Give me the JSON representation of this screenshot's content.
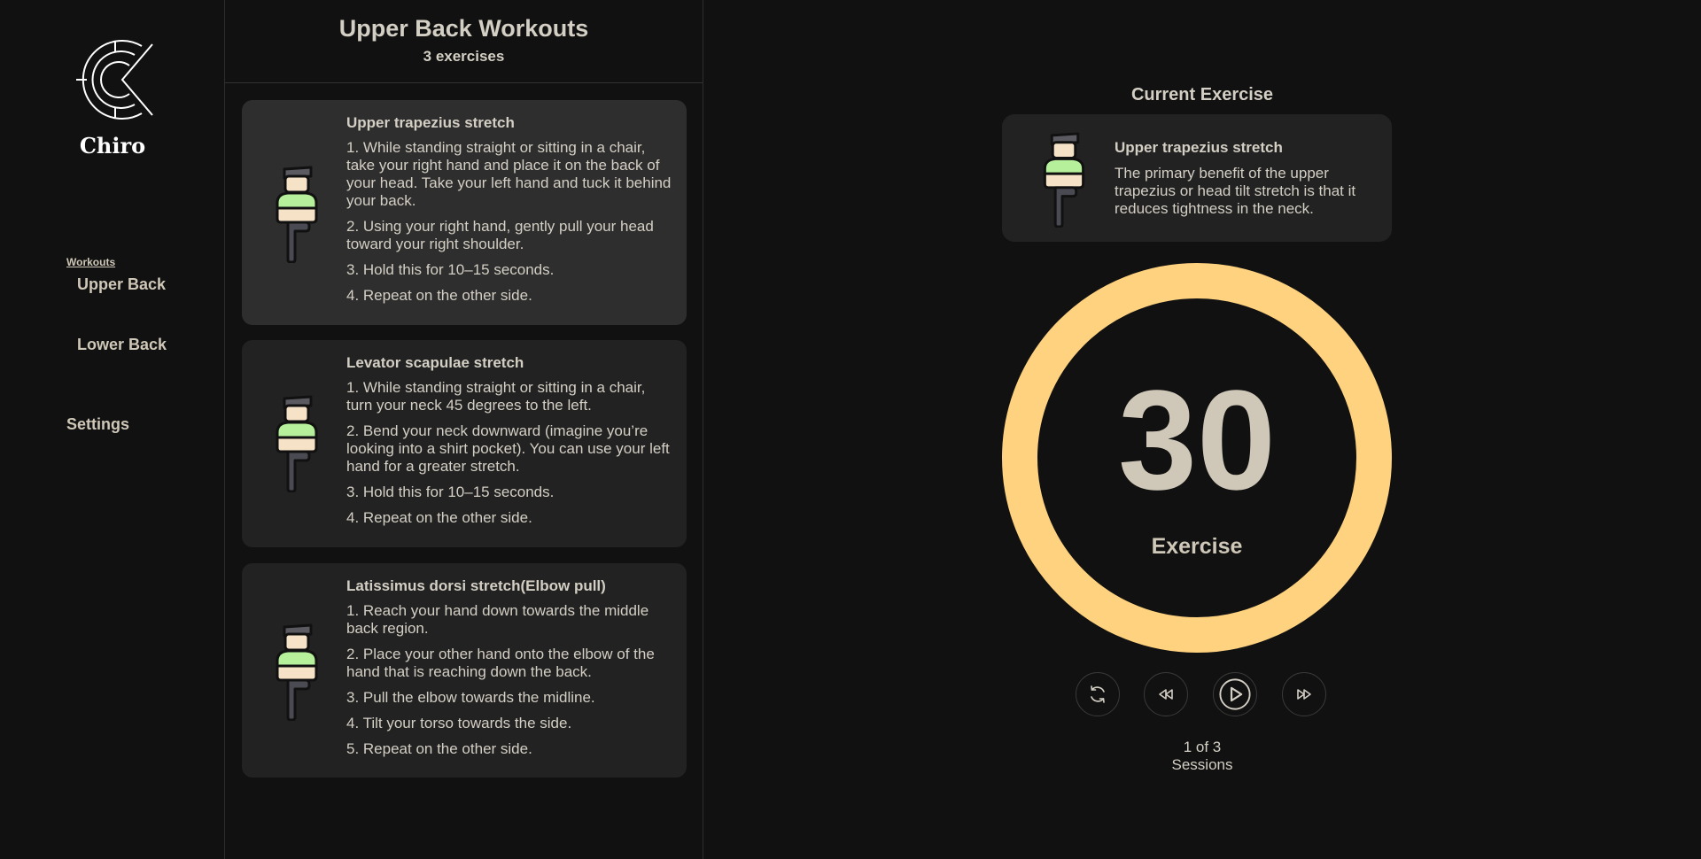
{
  "brand": {
    "name": "Chiro"
  },
  "nav": {
    "section_label": "Workouts",
    "items": [
      {
        "label": "Upper Back"
      },
      {
        "label": "Lower Back"
      }
    ],
    "settings_label": "Settings"
  },
  "list": {
    "title": "Upper Back Workouts",
    "count": "3 exercises",
    "exercises": [
      {
        "title": "Upper trapezius stretch",
        "steps": [
          "1. While standing straight or sitting in a chair, take your right hand and place it on the back of your head. Take your left hand and tuck it behind your back.",
          "2. Using your right hand, gently pull your head toward your right shoulder.",
          "3. Hold this for 10–15 seconds.",
          "4. Repeat on the other side."
        ]
      },
      {
        "title": "Levator scapulae stretch",
        "steps": [
          "1. While standing straight or sitting in a chair, turn your neck 45 degrees to the left.",
          "2. Bend your neck downward (imagine you’re looking into a shirt pocket). You can use your left hand for a greater stretch.",
          "3. Hold this for 10–15 seconds.",
          "4. Repeat on the other side."
        ]
      },
      {
        "title": "Latissimus dorsi stretch(Elbow pull)",
        "steps": [
          "1. Reach your hand down towards the middle back region.",
          "2. Place your other hand onto the elbow of the hand that is reaching down the back.",
          "3. Pull the elbow towards the midline.",
          "4. Tilt your torso towards the side.",
          "5. Repeat on the other side."
        ]
      }
    ]
  },
  "player": {
    "current_label": "Current Exercise",
    "current": {
      "title": "Upper trapezius stretch",
      "description": "The primary benefit of the upper trapezius or head tilt stretch is that it reduces tightness in the neck."
    },
    "timer": {
      "value": "30",
      "label": "Exercise",
      "progress": 1.0
    },
    "session": {
      "count": "1 of 3",
      "label": "Sessions"
    }
  },
  "colors": {
    "background": "#111111",
    "card": "#222222",
    "card_active": "#2e2e2e",
    "ring": "#ffd27f",
    "text": "#d4cfc4",
    "figure_shirt": "#b6f09a",
    "figure_skin": "#f6e2c6"
  },
  "icons": {
    "logo": "chiro-logo",
    "figure": "stretch-figure-icon",
    "reset": "reset-icon",
    "prev": "rewind-icon",
    "play": "play-icon",
    "next": "fast-forward-icon"
  }
}
